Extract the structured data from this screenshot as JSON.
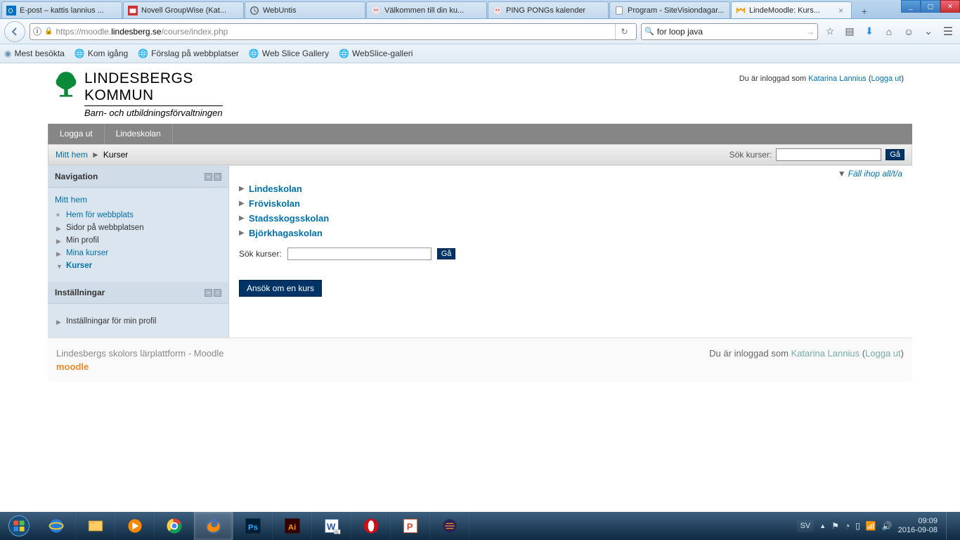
{
  "window": {
    "min": "_",
    "max": "▢",
    "close": "✕"
  },
  "tabs": [
    {
      "label": "E-post – kattis lannius ..."
    },
    {
      "label": "Novell GroupWise (Kat..."
    },
    {
      "label": "WebUntis"
    },
    {
      "label": "Välkommen till din ku..."
    },
    {
      "label": "PING PONGs kalender"
    },
    {
      "label": "Program - SiteVisiondagar..."
    },
    {
      "label": "LindeMoodle: Kurs...",
      "active": true
    }
  ],
  "newtab": "+",
  "addr": {
    "scheme": "https://",
    "sub": "moodle.",
    "domain": "lindesberg.se",
    "path": "/course/index.php"
  },
  "search": {
    "query": "for loop java"
  },
  "bookmarks": [
    "Mest besökta",
    "Kom igång",
    "Förslag på webbplatser",
    "Web Slice Gallery",
    "WebSlice-galleri"
  ],
  "site": {
    "logo_top": "LINDESBERGS",
    "logo_bottom": "KOMMUN",
    "logo_sub": "Barn- och utbildningsförvaltningen",
    "logged_pre": "Du är inloggad som ",
    "user": "Katarina Lannius",
    "logout": "Logga ut"
  },
  "topmenu": [
    "Logga ut",
    "Lindeskolan"
  ],
  "breadcrumb": {
    "home": "Mitt hem",
    "current": "Kurser",
    "search_label": "Sök kurser:",
    "go": "Gå"
  },
  "nav_block": {
    "title": "Navigation",
    "root": "Mitt hem",
    "items": [
      {
        "label": "Hem för webbplats",
        "type": "sq",
        "link": true
      },
      {
        "label": "Sidor på webbplatsen",
        "type": "tri",
        "link": false
      },
      {
        "label": "Min profil",
        "type": "tri",
        "link": false
      },
      {
        "label": "Mina kurser",
        "type": "tri",
        "link": true
      },
      {
        "label": "Kurser",
        "type": "down",
        "link": true,
        "current": true
      }
    ]
  },
  "settings_block": {
    "title": "Inställningar",
    "items": [
      {
        "label": "Inställningar för min profil"
      }
    ]
  },
  "main": {
    "collapse": "Fäll ihop all/t/a",
    "courses": [
      "Lindeskolan",
      "Fröviskolan",
      "Stadsskogsskolan",
      "Björkhagaskolan"
    ],
    "search_label": "Sök kurser:",
    "go": "Gå",
    "apply": "Ansök om en kurs"
  },
  "footer": {
    "left": "Lindesbergs skolors lärplattform - Moodle",
    "moodle": "moodle",
    "pre": "Du är inloggad som ",
    "user": "Katarina Lannius",
    "logout": "Logga ut"
  },
  "tray": {
    "lang": "SV",
    "time": "09:09",
    "date": "2016-09-08"
  }
}
